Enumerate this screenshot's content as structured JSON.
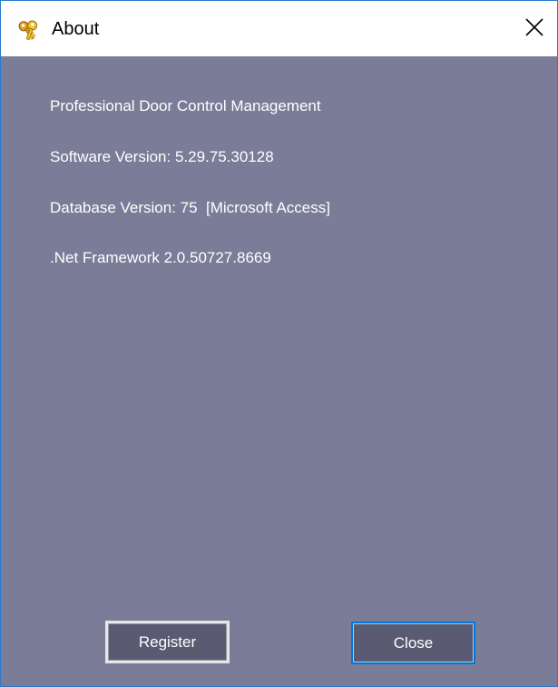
{
  "window": {
    "title": "About",
    "title_icon": "keys-icon",
    "close_icon": "close-icon"
  },
  "info": {
    "product": "Professional Door Control Management",
    "software_version": "Software Version: 5.29.75.30128",
    "database_version": "Database Version: 75  [Microsoft Access]",
    "framework": ".Net Framework 2.0.50727.8669"
  },
  "buttons": {
    "register": "Register",
    "close": "Close"
  },
  "colors": {
    "background": "#7b7d98",
    "button_face": "#5a5a72",
    "focus_border": "#0078d7",
    "window_border": "#2b79d0"
  }
}
